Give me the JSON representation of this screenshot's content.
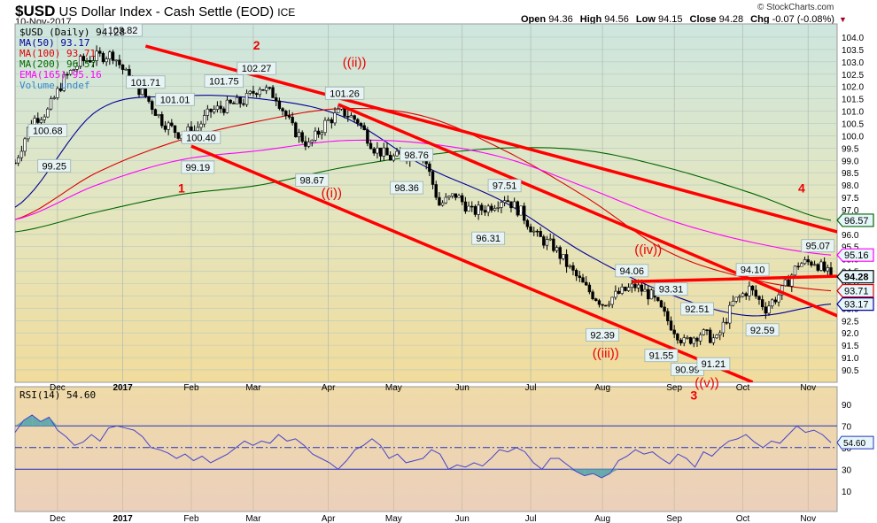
{
  "header": {
    "symbol": "$USD",
    "name": "US Dollar Index - Cash Settle (EOD)",
    "exchange": "ICE",
    "date": "10-Nov-2017",
    "copyright": "© StockCharts.com",
    "open_label": "Open",
    "open": "94.36",
    "high_label": "High",
    "high": "94.56",
    "low_label": "Low",
    "low": "94.15",
    "close_label": "Close",
    "close": "94.28",
    "chg_label": "Chg",
    "chg": "-0.07 (-0.08%)",
    "chg_icon": "down-triangle-icon"
  },
  "legend": {
    "price": "$USD (Daily) 94.28",
    "ma50": "MA(50) 93.17",
    "ma100": "MA(100) 93.71",
    "ma200": "MA(200) 96.57",
    "ema165": "EMA(165) 95.16",
    "volume": "Volume undef",
    "rsi": "RSI(14) 54.60"
  },
  "colors": {
    "ma50": "#000099",
    "ma100": "#dd0000",
    "ma200": "#006600",
    "ema165": "#ff00ff",
    "trend": "#ff0000",
    "wave": "#ee0000",
    "rsi": "#4444cc",
    "rsi_fill": "#66aaaa"
  },
  "chart_data": {
    "type": "candlestick",
    "title": "$USD US Dollar Index - Cash Settle (EOD) ICE",
    "x_unit": "trading day index (0 = mid-Nov 2016, 250 = 10-Nov-2017)",
    "xlim": [
      0,
      252
    ],
    "ylim": [
      90.5,
      104.0
    ],
    "y_ticks": [
      90.5,
      91.0,
      91.5,
      92.0,
      92.5,
      93.0,
      93.5,
      94.0,
      94.5,
      95.0,
      95.5,
      96.0,
      96.5,
      97.0,
      97.5,
      98.0,
      98.5,
      99.0,
      99.5,
      100.0,
      100.5,
      101.0,
      101.5,
      102.0,
      102.5,
      103.0,
      103.5,
      104.0
    ],
    "month_ticks": [
      {
        "label": "Dec",
        "day": 13
      },
      {
        "label": "2017",
        "day": 33,
        "bold": true
      },
      {
        "label": "Feb",
        "day": 54
      },
      {
        "label": "Mar",
        "day": 73
      },
      {
        "label": "Apr",
        "day": 96
      },
      {
        "label": "May",
        "day": 116
      },
      {
        "label": "Jun",
        "day": 137
      },
      {
        "label": "Jul",
        "day": 158
      },
      {
        "label": "Aug",
        "day": 180
      },
      {
        "label": "Sep",
        "day": 202
      },
      {
        "label": "Oct",
        "day": 223
      },
      {
        "label": "Nov",
        "day": 243
      }
    ],
    "close_every_5_days": [
      98.9,
      100.6,
      101.0,
      102.3,
      103.0,
      103.2,
      103.3,
      102.3,
      101.6,
      100.6,
      100.1,
      100.2,
      101.0,
      101.2,
      101.4,
      102.0,
      101.6,
      100.3,
      99.6,
      100.5,
      101.0,
      100.6,
      99.5,
      99.1,
      99.2,
      99.3,
      97.2,
      97.6,
      96.9,
      97.1,
      97.5,
      96.9,
      95.9,
      95.5,
      94.6,
      93.8,
      93.2,
      93.6,
      93.9,
      93.5,
      92.5,
      91.6,
      92.0,
      91.7,
      93.2,
      93.8,
      93.0,
      93.7,
      94.8,
      94.9,
      94.28
    ],
    "overlays_every_25_days": {
      "ma50": [
        97.1,
        101.0,
        101.6,
        101.5,
        100.8,
        98.8,
        97.3,
        95.2,
        93.6,
        92.7,
        93.17
      ],
      "ma100": [
        96.6,
        98.5,
        99.8,
        100.6,
        101.1,
        100.8,
        99.4,
        97.5,
        95.3,
        94.2,
        93.71
      ],
      "ma200": [
        96.1,
        96.9,
        97.6,
        98.0,
        98.7,
        99.2,
        99.5,
        99.4,
        98.7,
        97.7,
        96.57
      ],
      "ema165": [
        96.6,
        98.0,
        99.0,
        99.4,
        99.8,
        99.7,
        99.1,
        97.9,
        96.6,
        95.7,
        95.16
      ]
    },
    "last_values": [
      {
        "key": "ma200",
        "text": "96.57"
      },
      {
        "key": "ema165",
        "text": "95.16"
      },
      {
        "key": "close",
        "text": "94.28"
      },
      {
        "key": "ma100",
        "text": "93.71"
      },
      {
        "key": "ma50",
        "text": "93.17"
      }
    ],
    "annotations": [
      {
        "text": "103.82",
        "day": 33,
        "price": 103.82,
        "pos": "above"
      },
      {
        "text": "101.71",
        "day": 40,
        "price": 101.71,
        "pos": "above"
      },
      {
        "text": "101.01",
        "day": 49,
        "price": 101.01,
        "pos": "above"
      },
      {
        "text": "101.75",
        "day": 64,
        "price": 101.75,
        "pos": "above"
      },
      {
        "text": "100.40",
        "day": 57,
        "price": 100.4,
        "pos": "below"
      },
      {
        "text": "100.68",
        "day": 10,
        "price": 100.68,
        "pos": "below"
      },
      {
        "text": "99.25",
        "day": 12,
        "price": 99.25,
        "pos": "below"
      },
      {
        "text": "99.19",
        "day": 56,
        "price": 99.19,
        "pos": "below"
      },
      {
        "text": "102.27",
        "day": 74,
        "price": 102.27,
        "pos": "above"
      },
      {
        "text": "101.26",
        "day": 101,
        "price": 101.26,
        "pos": "above"
      },
      {
        "text": "98.76",
        "day": 123,
        "price": 98.76,
        "pos": "above"
      },
      {
        "text": "98.67",
        "day": 91,
        "price": 98.67,
        "pos": "below"
      },
      {
        "text": "98.36",
        "day": 120,
        "price": 98.36,
        "pos": "below"
      },
      {
        "text": "97.51",
        "day": 150,
        "price": 97.51,
        "pos": "above"
      },
      {
        "text": "96.31",
        "day": 145,
        "price": 96.31,
        "pos": "below"
      },
      {
        "text": "92.39",
        "day": 180,
        "price": 92.39,
        "pos": "below"
      },
      {
        "text": "94.06",
        "day": 189,
        "price": 94.06,
        "pos": "above"
      },
      {
        "text": "93.31",
        "day": 201,
        "price": 93.31,
        "pos": "above"
      },
      {
        "text": "92.51",
        "day": 209,
        "price": 92.51,
        "pos": "above"
      },
      {
        "text": "91.55",
        "day": 198,
        "price": 91.55,
        "pos": "below"
      },
      {
        "text": "90.99",
        "day": 206,
        "price": 90.99,
        "pos": "below"
      },
      {
        "text": "91.21",
        "day": 214,
        "price": 91.21,
        "pos": "below"
      },
      {
        "text": "94.10",
        "day": 226,
        "price": 94.1,
        "pos": "above"
      },
      {
        "text": "92.59",
        "day": 229,
        "price": 92.59,
        "pos": "below"
      },
      {
        "text": "95.07",
        "day": 246,
        "price": 95.07,
        "pos": "above"
      }
    ],
    "wave_labels": [
      {
        "text": "2",
        "day": 74,
        "price": 103.5
      },
      {
        "text": "((ii))",
        "day": 104,
        "price": 102.8
      },
      {
        "text": "1",
        "day": 51,
        "price": 97.7
      },
      {
        "text": "((i))",
        "day": 97,
        "price": 97.5
      },
      {
        "text": "((iii))",
        "day": 181,
        "price": 91.0
      },
      {
        "text": "((iv))",
        "day": 194,
        "price": 95.2
      },
      {
        "text": "((v))",
        "day": 212,
        "price": 89.8
      },
      {
        "text": "3",
        "day": 208,
        "price": 89.3
      },
      {
        "text": "4",
        "day": 241,
        "price": 97.7
      }
    ],
    "trend_lines": [
      {
        "from": [
          40,
          103.64
        ],
        "to": [
          252,
          96.1
        ]
      },
      {
        "from": [
          99,
          101.27
        ],
        "to": [
          252,
          92.69
        ]
      },
      {
        "from": [
          54,
          99.58
        ],
        "to": [
          226,
          90.0
        ]
      },
      {
        "from": [
          189,
          94.08
        ],
        "to": [
          252,
          94.3
        ]
      }
    ],
    "rsi": {
      "ylim": [
        0,
        100
      ],
      "y_ticks": [
        10,
        30,
        50,
        70,
        90
      ],
      "levels": [
        30,
        50,
        70
      ],
      "last": "54.60",
      "values": [
        64,
        75,
        80,
        74,
        78,
        66,
        60,
        52,
        55,
        62,
        56,
        68,
        70,
        68,
        66,
        60,
        50,
        48,
        45,
        40,
        44,
        38,
        42,
        36,
        40,
        44,
        50,
        56,
        52,
        56,
        54,
        62,
        56,
        58,
        52,
        44,
        40,
        36,
        30,
        38,
        48,
        52,
        58,
        52,
        40,
        44,
        36,
        38,
        40,
        48,
        44,
        30,
        34,
        32,
        36,
        33,
        40,
        48,
        46,
        50,
        46,
        36,
        30,
        40,
        40,
        34,
        28,
        24,
        26,
        22,
        26,
        38,
        42,
        48,
        44,
        46,
        40,
        35,
        44,
        40,
        32,
        46,
        42,
        50,
        56,
        58,
        62,
        55,
        50,
        56,
        54,
        62,
        70,
        64,
        66,
        62,
        54.6
      ]
    }
  }
}
